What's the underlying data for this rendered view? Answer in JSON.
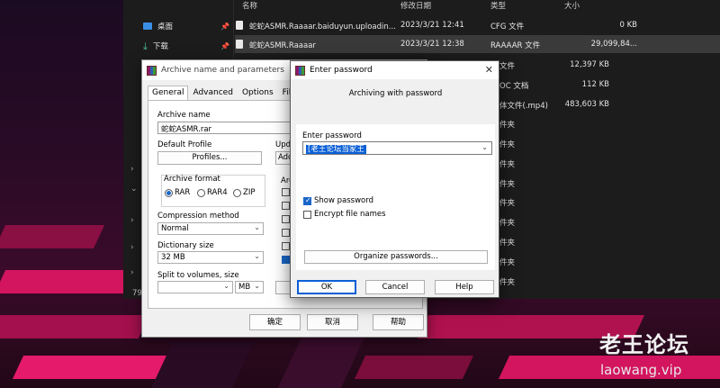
{
  "explorer": {
    "headers": {
      "name": "名称",
      "date": "修改日期",
      "type": "类型",
      "size": "大小"
    },
    "sidebar": [
      {
        "label": "桌面",
        "icon": "desktop-icon"
      },
      {
        "label": "下载",
        "icon": "download-icon"
      }
    ],
    "item_count": "79",
    "files": [
      {
        "name": "蛇蛇ASMR.Raaaar.baiduyun.uploadin...",
        "date": "2023/3/21 12:41",
        "type": "CFG 文件",
        "size": "0 KB",
        "selected": false
      },
      {
        "name": "蛇蛇ASMR.Raaaar",
        "date": "2023/3/21 12:38",
        "type": "RAAAAR 文件",
        "size": "29,099,84...",
        "selected": true
      }
    ],
    "partial_types": [
      "文件",
      "OC 文档",
      "体文件(.mp4)",
      "件夹",
      "件夹",
      "件夹",
      "件夹",
      "件夹",
      "件夹",
      "件夹",
      "件夹",
      "件夹"
    ],
    "partial_sizes": [
      "12,397 KB",
      "112 KB",
      "483,603 KB"
    ]
  },
  "archive_dialog": {
    "title": "Archive name and parameters",
    "tabs": [
      "General",
      "Advanced",
      "Options",
      "Files"
    ],
    "archive_name_label": "Archive name",
    "archive_name_value": "蛇蛇ASMR.rar",
    "default_profile_label": "Default Profile",
    "profiles_button": "Profiles...",
    "update_label": "Upda",
    "add_label": "Add",
    "archive_format_label": "Archive format",
    "formats": [
      "RAR",
      "RAR4",
      "ZIP"
    ],
    "selected_format": "RAR",
    "archiving_options_label": "Arc",
    "compression_label": "Compression method",
    "compression_value": "Normal",
    "dictionary_label": "Dictionary size",
    "dictionary_value": "32 MB",
    "split_label": "Split to volumes, size",
    "split_unit": "MB",
    "buttons": {
      "ok": "确定",
      "cancel": "取消",
      "help": "帮助"
    }
  },
  "password_dialog": {
    "title": "Enter password",
    "subtitle": "Archiving with password",
    "password_label": "Enter password",
    "password_value": "[老王论坛当家王",
    "show_password_label": "Show password",
    "show_password_checked": true,
    "encrypt_names_label": "Encrypt file names",
    "encrypt_names_checked": false,
    "organize_button": "Organize passwords...",
    "buttons": {
      "ok": "OK",
      "cancel": "Cancel",
      "help": "Help"
    }
  },
  "watermark": {
    "cn": "老王论坛",
    "url": "laowang.vip"
  }
}
